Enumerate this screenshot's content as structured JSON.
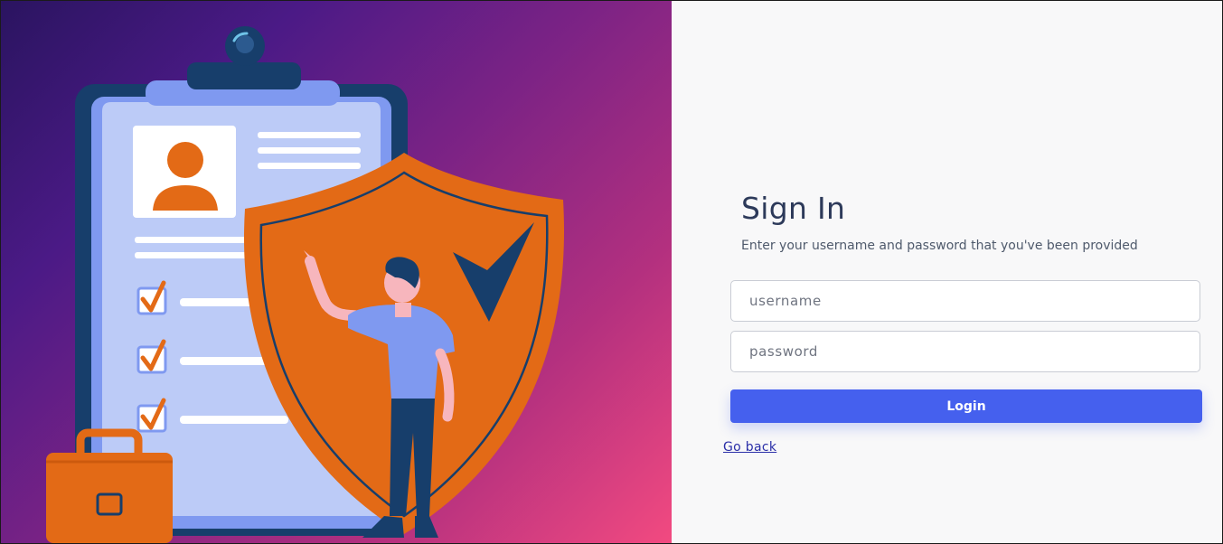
{
  "signin": {
    "title": "Sign In",
    "subtitle": "Enter your username and password that you've been provided"
  },
  "form": {
    "username_placeholder": "username",
    "password_placeholder": "password",
    "login_label": "Login",
    "go_back_label": "Go back"
  },
  "colors": {
    "primary": "#4560ee",
    "illustration_orange": "#e36a16",
    "illustration_navy": "#173e6b",
    "gradient_start": "#2a1460",
    "gradient_end": "#f24a80"
  },
  "illustration": {
    "icons": [
      "clipboard-icon",
      "profile-card-icon",
      "checkbox-icon",
      "shield-check-icon",
      "person-figure",
      "briefcase-icon"
    ]
  }
}
